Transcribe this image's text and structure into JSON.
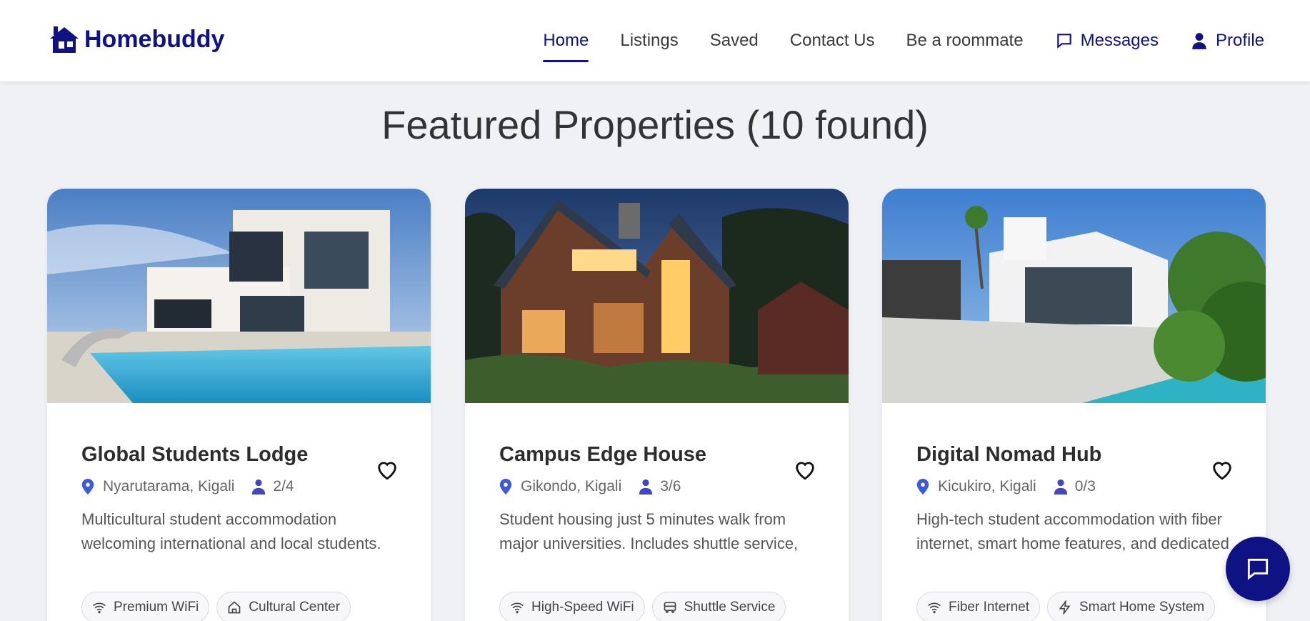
{
  "brand": {
    "name": "Homebuddy",
    "color": "#0f1283"
  },
  "nav": {
    "home": "Home",
    "listings": "Listings",
    "saved": "Saved",
    "contact": "Contact Us",
    "roommate": "Be a roommate",
    "messages": "Messages",
    "profile": "Profile"
  },
  "heading": "Featured Properties (10 found)",
  "cards": [
    {
      "title": "Global Students Lodge",
      "location": "Nyarutarama, Kigali",
      "occupancy": "2/4",
      "description": "Multicultural student accommodation welcoming international and local students. Features cultural exchange programs and",
      "tags": [
        {
          "label": "Premium WiFi",
          "icon": "wifi-icon"
        },
        {
          "label": "Cultural Center",
          "icon": "home-icon"
        }
      ]
    },
    {
      "title": "Campus Edge House",
      "location": "Gikondo, Kigali",
      "occupancy": "3/6",
      "description": "Student housing just 5 minutes walk from major universities. Includes shuttle service, library access, and academic support",
      "tags": [
        {
          "label": "High-Speed WiFi",
          "icon": "wifi-icon"
        },
        {
          "label": "Shuttle Service",
          "icon": "bus-icon"
        }
      ]
    },
    {
      "title": "Digital Nomad Hub",
      "location": "Kicukiro, Kigali",
      "occupancy": "0/3",
      "description": "High-tech student accommodation with fiber internet, smart home features, and dedicated workspace. Perfect for IT and",
      "tags": [
        {
          "label": "Fiber Internet",
          "icon": "wifi-icon"
        },
        {
          "label": "Smart Home System",
          "icon": "lightning-icon"
        }
      ]
    }
  ],
  "colors": {
    "accent": "#0f1283",
    "pin": "#3b5bdb",
    "person": "#4046c8",
    "background": "#f0f1f4"
  }
}
